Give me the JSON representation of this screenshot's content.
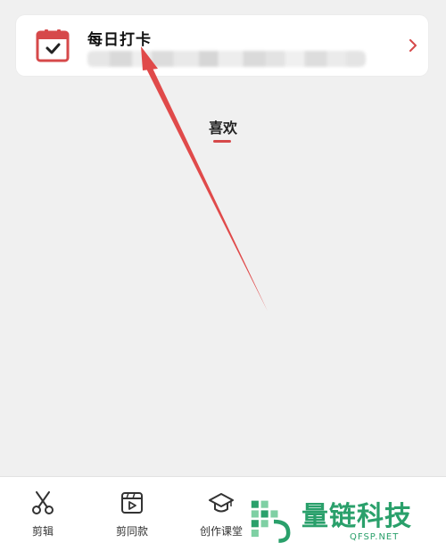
{
  "card": {
    "title": "每日打卡",
    "icon": "calendar-check-icon",
    "chevron_icon": "chevron-right-icon"
  },
  "tabs": {
    "active_label": "喜欢"
  },
  "colors": {
    "accent_red": "#d6494a",
    "arrow_red": "#e04a4a",
    "watermark_green": "#2aa06b"
  },
  "bottom_nav": {
    "items": [
      {
        "label": "剪辑",
        "icon": "scissors-icon"
      },
      {
        "label": "剪同款",
        "icon": "video-template-icon"
      },
      {
        "label": "创作课堂",
        "icon": "graduation-cap-icon"
      }
    ]
  },
  "watermark": {
    "text": "量链科技",
    "sub": "QFSP.NET"
  }
}
